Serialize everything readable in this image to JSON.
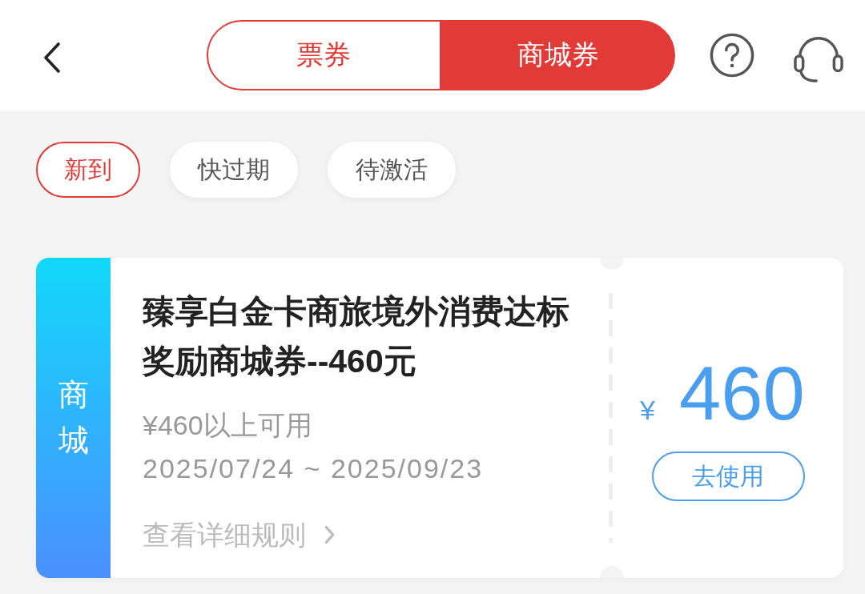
{
  "header": {
    "tabs": [
      {
        "label": "票券",
        "selected": false
      },
      {
        "label": "商城券",
        "selected": true
      }
    ]
  },
  "filters": [
    {
      "label": "新到",
      "selected": true
    },
    {
      "label": "快过期",
      "selected": false
    },
    {
      "label": "待激活",
      "selected": false
    }
  ],
  "coupons": [
    {
      "category": "商城",
      "title": "臻享白金卡商旅境外消费达标奖励商城券--460元",
      "condition": "¥460以上可用",
      "validity": "2025/07/24 ~ 2025/09/23",
      "rules_link": "查看详细规则",
      "currency": "¥",
      "amount": "460",
      "action": "去使用"
    }
  ]
}
